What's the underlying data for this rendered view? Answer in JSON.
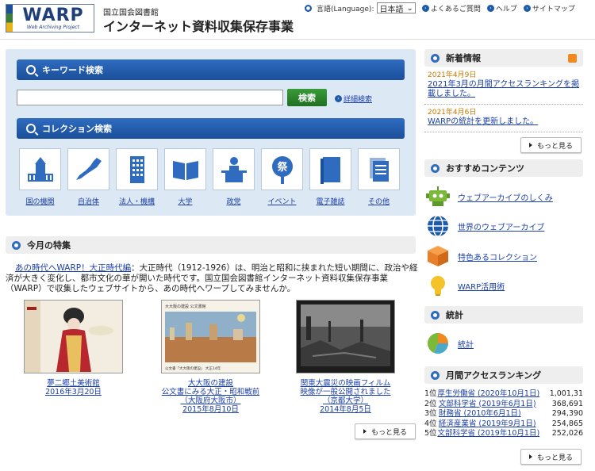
{
  "header": {
    "logo_main": "WARP",
    "logo_sub": "Web Archiving Project",
    "org": "国立国会図書館",
    "title": "インターネット資料収集保存事業",
    "lang_label": "言語(Language):",
    "lang_value": "日本語",
    "faq": "よくあるご質問",
    "help": "ヘルプ",
    "sitemap": "サイトマップ"
  },
  "search": {
    "keyword_title": "キーワード検索",
    "keyword_value": "",
    "button": "検索",
    "advanced": "詳細検索",
    "collection_title": "コレクション検索",
    "collections": [
      {
        "label": "国の機関",
        "icon": "government-building-icon"
      },
      {
        "label": "自治体",
        "icon": "japan-map-icon"
      },
      {
        "label": "法人・機構",
        "icon": "office-building-icon"
      },
      {
        "label": "大学",
        "icon": "open-book-icon"
      },
      {
        "label": "政党",
        "icon": "speaker-podium-icon"
      },
      {
        "label": "イベント",
        "icon": "festival-fan-icon"
      },
      {
        "label": "電子雑誌",
        "icon": "magazine-icon"
      },
      {
        "label": "その他",
        "icon": "documents-icon"
      }
    ]
  },
  "feature": {
    "heading": "今月の特集",
    "link": "あの時代へWARP！大正時代編",
    "text": "：大正時代（1912-1926）は、明治と昭和に挟まれた短い期間に、政治や経済が大きく変化し、都市文化の華が開いた時代です。国立国会図書館インターネット資料収集保存事業（WARP）で収集したウェブサイトから、あの時代へワープしてみませんか。",
    "cards": [
      {
        "lines": [
          "夢二郷土美術館",
          "2016年3月20日"
        ]
      },
      {
        "lines": [
          "大大阪の建設",
          "公文書にみる大正・昭和戦前",
          "（大阪府大阪市）",
          "2015年8月10日"
        ]
      },
      {
        "lines": [
          "関東大震災の映画フィルム",
          "映像が一般公開されました",
          "（京都大学）",
          "2014年8月5日"
        ]
      }
    ],
    "card2_banner": "大大阪の建設  公文書館",
    "card2_caption": "公文書「大大阪の建設」 大正14年",
    "more": "もっと見る"
  },
  "news": {
    "heading": "新着情報",
    "items": [
      {
        "date": "2021年4月9日",
        "text": "2021年3月の月間アクセスランキングを掲載しました。"
      },
      {
        "date": "2021年4月6日",
        "text": "WARPの統計を更新しました。"
      }
    ],
    "more": "もっと見る"
  },
  "recommend": {
    "heading": "おすすめコンテンツ",
    "items": [
      {
        "label": "ウェブアーカイブのしくみ",
        "icon": "robot-icon"
      },
      {
        "label": "世界のウェブアーカイブ",
        "icon": "globe-icon"
      },
      {
        "label": "特色あるコレクション",
        "icon": "cube-icon"
      },
      {
        "label": "WARP活用術",
        "icon": "lightbulb-icon"
      }
    ]
  },
  "stats": {
    "heading": "統計",
    "label": "統計"
  },
  "ranking": {
    "heading": "月間アクセスランキング",
    "rows": [
      {
        "rank": "1位",
        "name": "厚生労働省 (2020年10月1日)",
        "count": "1,001,31"
      },
      {
        "rank": "2位",
        "name": "文部科学省 (2019年6月1日)",
        "count": "368,691"
      },
      {
        "rank": "3位",
        "name": "財務省 (2010年6月1日)",
        "count": "294,390"
      },
      {
        "rank": "4位",
        "name": "経済産業省 (2019年9月1日)",
        "count": "254,865"
      },
      {
        "rank": "5位",
        "name": "文部科学省 (2019年10月1日)",
        "count": "252,026"
      }
    ],
    "more": "もっと見る"
  },
  "colors": {
    "accent_blue": "#1f5aa8",
    "search_green": "#2f8a2f",
    "panel_bg": "#dce8f4",
    "date_orange": "#c47a00"
  }
}
